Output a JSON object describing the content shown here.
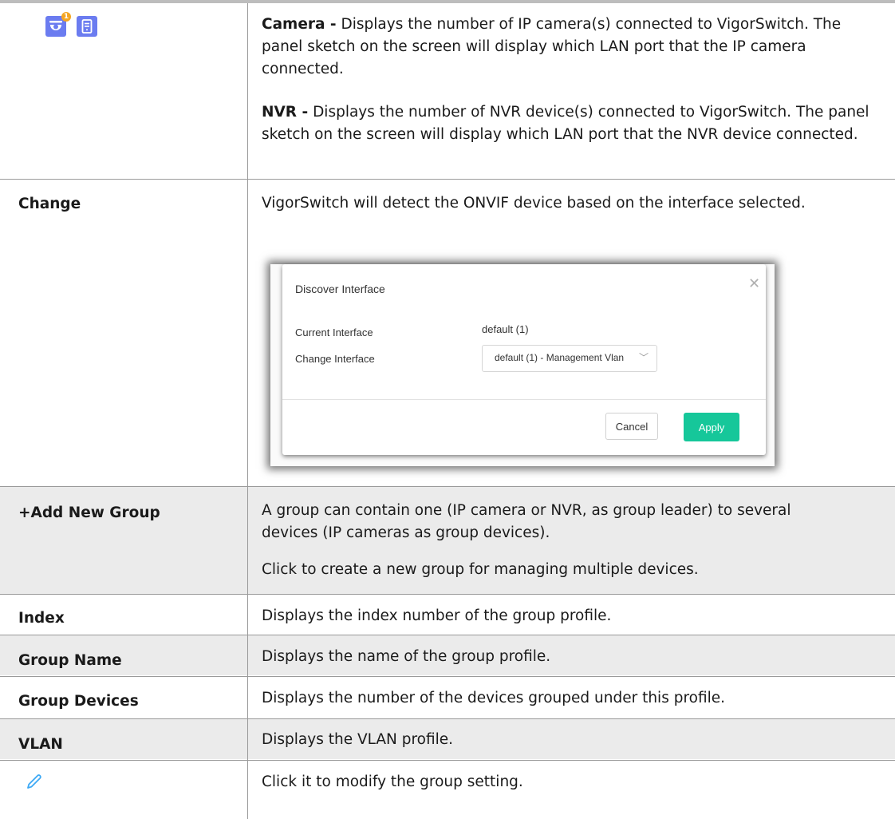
{
  "rows": [
    {
      "camera_title": "Camera -",
      "camera_desc": "Displays the number of IP camera(s) connected to VigorSwitch. The panel sketch on the screen will display which LAN port that the IP camera connected.",
      "camera_badge": "1",
      "nvr_title": "NVR -",
      "nvr_desc": "Displays the number of NVR device(s) connected to VigorSwitch. The panel sketch on the screen will display which LAN port that the NVR device connected."
    },
    {
      "term": "Change",
      "desc": "VigorSwitch will detect the ONVIF device based on the interface selected."
    },
    {
      "term": "+Add New Group",
      "desc": "A group can contain one (IP camera or NVR, as group leader) to several devices (IP cameras as group devices).",
      "desc2": "Click to create a new group for managing multiple devices."
    },
    {
      "term": "Index",
      "desc": "Displays the index number of the group profile."
    },
    {
      "term": "Group Name",
      "desc": "Displays the name of the group profile."
    },
    {
      "term": "Group Devices",
      "desc": "Displays the number of the devices grouped under this profile."
    },
    {
      "term": "VLAN",
      "desc": "Displays the VLAN profile."
    },
    {
      "term_icon": "pencil-icon",
      "desc": "Click it to modify the group setting."
    }
  ],
  "dialog": {
    "title": "Discover Interface",
    "current_label": "Current Interface",
    "current_value": "default (1)",
    "change_label": "Change Interface",
    "select_value": "default (1) - Management Vlan",
    "cancel_label": "Cancel",
    "apply_label": "Apply"
  },
  "colors": {
    "icon_blue": "#6b7cf0",
    "badge_orange": "#f5a623",
    "apply_green": "#16c79a",
    "pencil_blue": "#3da9f5",
    "row_gray": "#ebebeb"
  }
}
